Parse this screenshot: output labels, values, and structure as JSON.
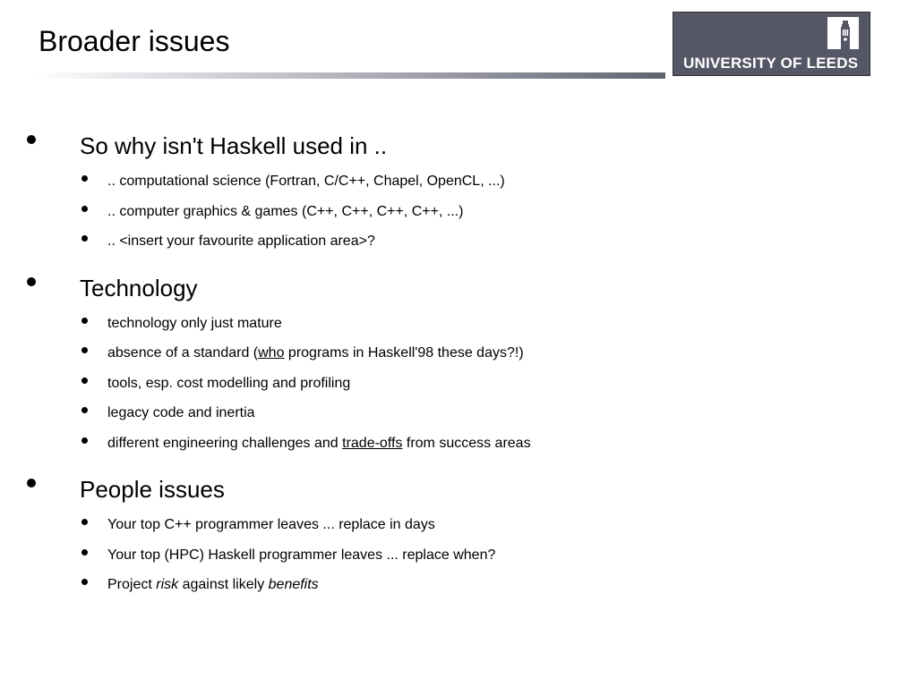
{
  "slide": {
    "title": "Broader issues",
    "logo": {
      "text": "UNIVERSITY OF LEEDS",
      "background_color": "#565766",
      "icon": "parkinson-tower-icon"
    },
    "sections": [
      {
        "heading": "So why isn't Haskell used in ..",
        "items": [
          {
            "text": ".. computational science (Fortran, C/C++, Chapel, OpenCL, ...)"
          },
          {
            "text": ".. computer graphics & games (C++, C++, C++, C++, ...)"
          },
          {
            "text": ".. <insert your favourite application area>?"
          }
        ]
      },
      {
        "heading": "Technology",
        "items": [
          {
            "text": "technology only just mature"
          },
          {
            "before": "absence of a standard (",
            "underlined": "who",
            "after": " programs in Haskell'98 these days?!)"
          },
          {
            "text": "tools, esp. cost modelling and profiling"
          },
          {
            "text": "legacy code and inertia"
          },
          {
            "before": "different engineering challenges and ",
            "underlined": "trade-offs",
            "after": " from success areas"
          }
        ]
      },
      {
        "heading": "People issues",
        "items": [
          {
            "text": "Your top C++ programmer leaves ... replace in days"
          },
          {
            "text": "Your top (HPC) Haskell programmer leaves ... replace when?"
          },
          {
            "before": "Project ",
            "italic1": "risk",
            "middle": " against likely ",
            "italic2": "benefits"
          }
        ]
      }
    ]
  }
}
